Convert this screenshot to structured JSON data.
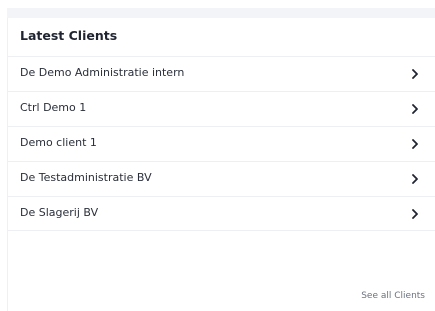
{
  "card": {
    "title": "Latest Clients",
    "see_all_label": "See all Clients"
  },
  "clients": [
    {
      "name": "De Demo Administratie intern"
    },
    {
      "name": "Ctrl Demo 1"
    },
    {
      "name": "Demo client 1"
    },
    {
      "name": "De Testadministratie BV"
    },
    {
      "name": "De Slagerij BV"
    }
  ],
  "icons": {
    "row_action": "chevron-right-icon"
  },
  "colors": {
    "text_primary": "#1f2430",
    "link_muted": "#6b7280",
    "divider": "#edeff2",
    "header_strip": "#f3f4f8"
  }
}
